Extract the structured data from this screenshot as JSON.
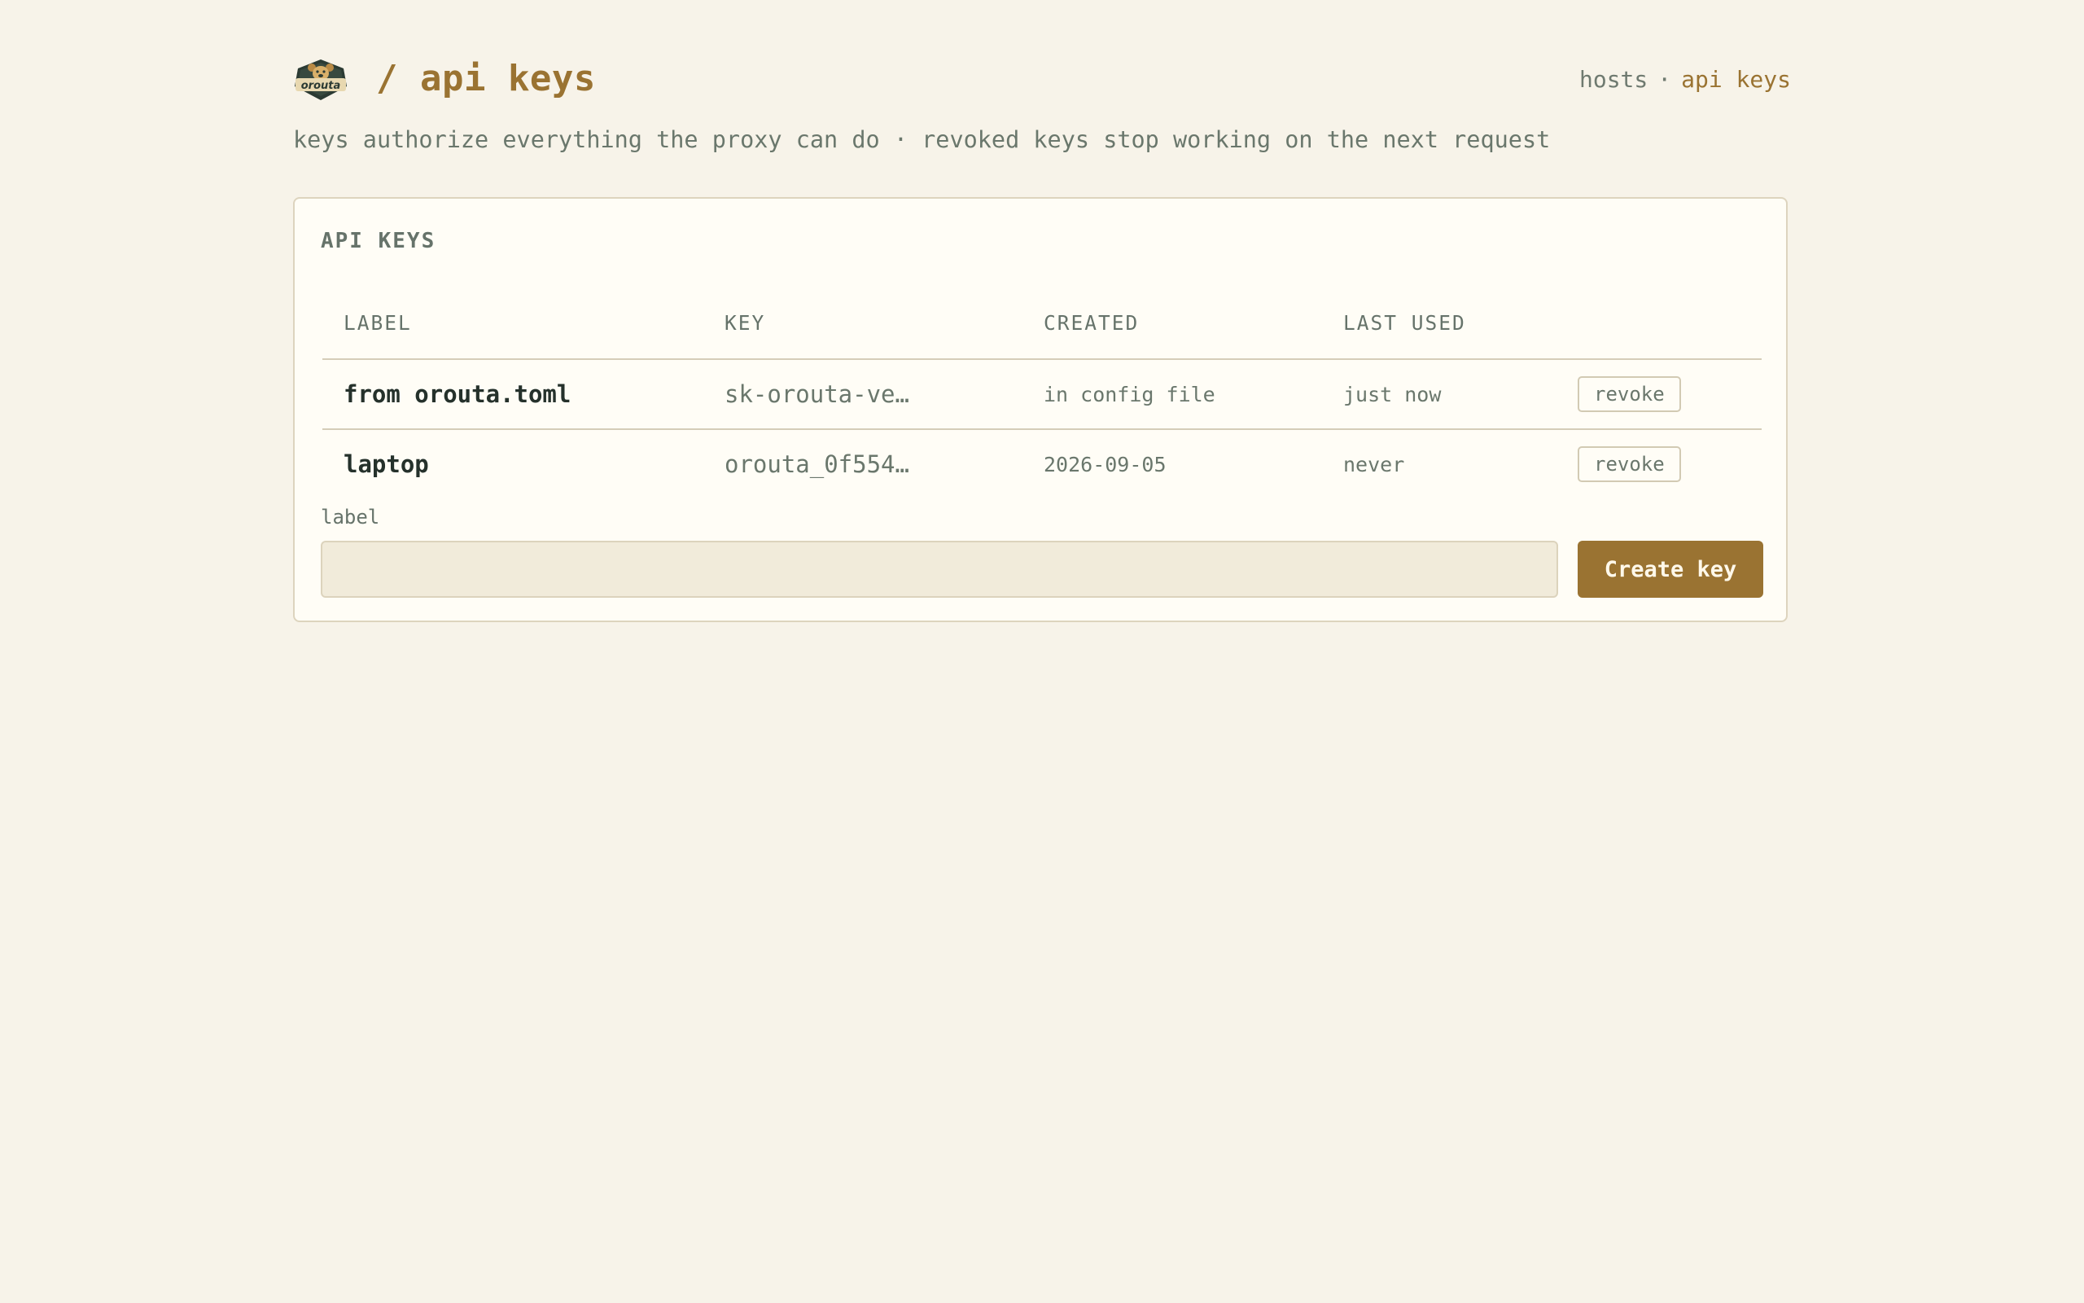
{
  "header": {
    "logo_text": "orouta",
    "title": "/ api keys",
    "subtitle": "keys authorize everything the proxy can do · revoked keys stop working on the next request",
    "nav": {
      "items": [
        {
          "label": "hosts",
          "active": false
        },
        {
          "label": "api keys",
          "active": true
        }
      ],
      "separator": "·"
    }
  },
  "card": {
    "title": "API KEYS",
    "columns": [
      "LABEL",
      "KEY",
      "CREATED",
      "LAST USED",
      ""
    ],
    "rows": [
      {
        "label": "from orouta.toml",
        "key": "sk-orouta-ve…",
        "created": "in config file",
        "last_used": "just now",
        "action": "revoke"
      },
      {
        "label": "laptop",
        "key": "orouta_0f554…",
        "created": "2026-09-05",
        "last_used": "never",
        "action": "revoke"
      }
    ]
  },
  "form": {
    "label": "label",
    "input_value": "",
    "input_placeholder": "",
    "submit_label": "Create key"
  },
  "colors": {
    "background": "#f7f3e9",
    "accent": "#9a7332",
    "card": "#fffdf6",
    "muted_text": "#6a776c"
  },
  "icons": {
    "logo": "orouta-dog-logo"
  }
}
